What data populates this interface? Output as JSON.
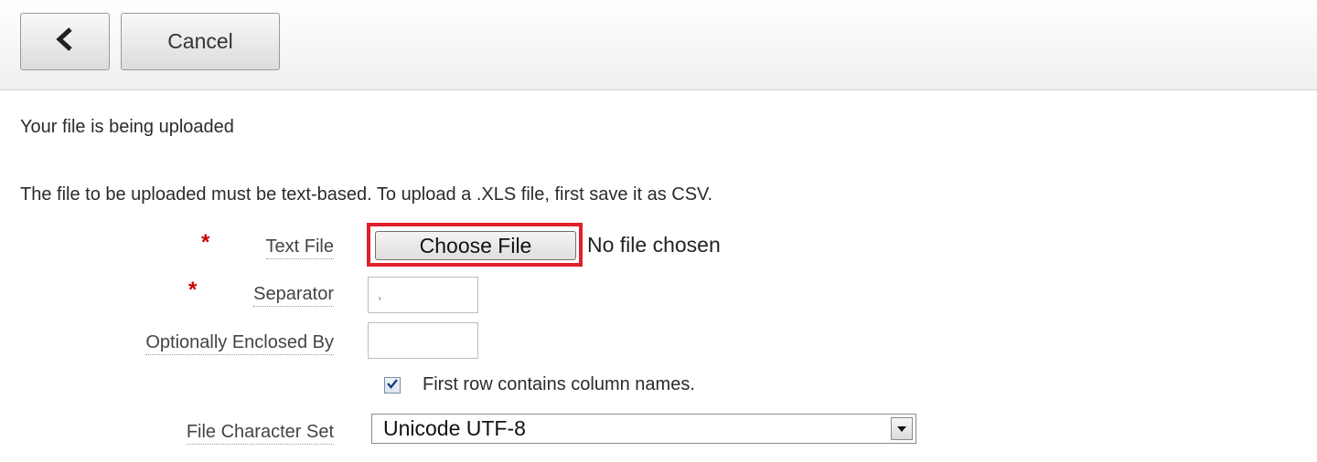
{
  "toolbar": {
    "back_icon": "chevron-left-icon",
    "cancel_label": "Cancel"
  },
  "status_message": "Your file is being uploaded",
  "instruction_text": "The file to be uploaded must be text-based. To upload a .XLS file, first save it as CSV.",
  "form": {
    "required_marker": "*",
    "text_file": {
      "label": "Text File",
      "button_label": "Choose File",
      "status": "No file chosen"
    },
    "separator": {
      "label": "Separator",
      "value": ","
    },
    "enclosed_by": {
      "label": "Optionally Enclosed By",
      "value": ""
    },
    "first_row": {
      "label": "First row contains column names.",
      "checked": true
    },
    "charset": {
      "label": "File Character Set",
      "selected": "Unicode UTF-8"
    }
  },
  "colors": {
    "required": "#cc0000",
    "highlight": "#e0202e"
  }
}
